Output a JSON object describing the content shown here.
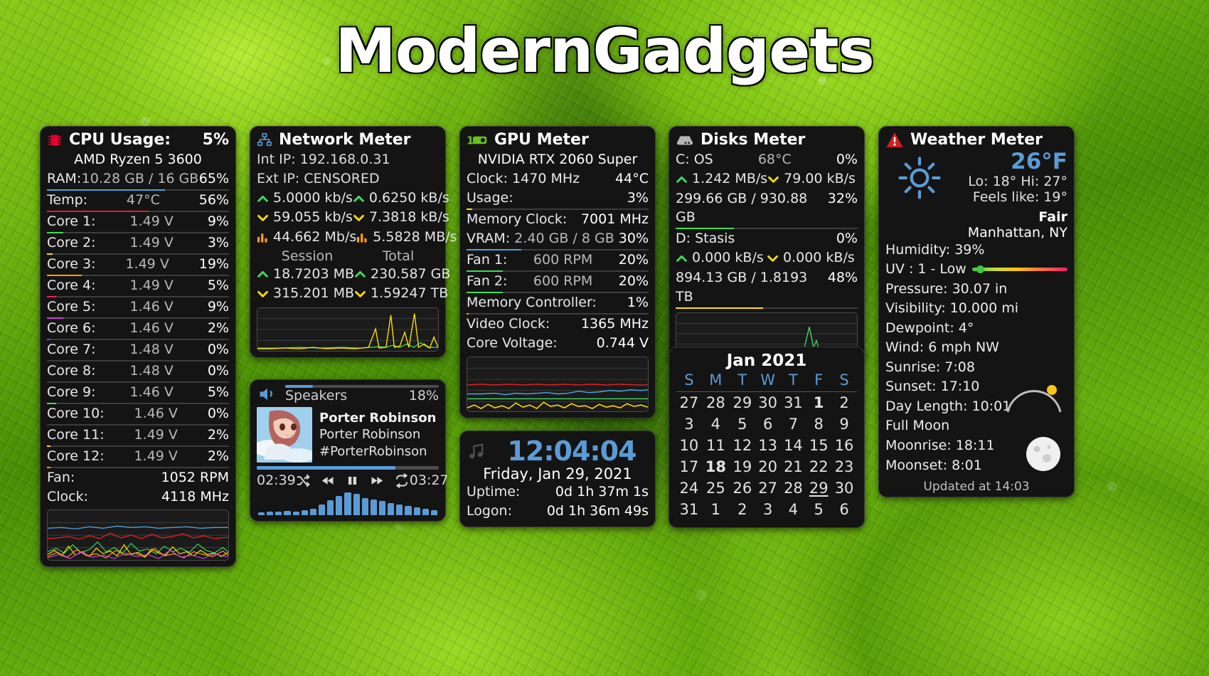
{
  "desktop": {
    "title": "ModernGadgets"
  },
  "cpu": {
    "icon": "cpu-chip-icon",
    "title": "CPU Usage:",
    "usage": "5%",
    "model": "AMD Ryzen 5 3600",
    "ram": {
      "label": "RAM:",
      "value": "10.28 GB / 16 GB",
      "pct": "65%",
      "bar_color": "#4aa3e0",
      "bar_pct": 65
    },
    "temp": {
      "label": "Temp:",
      "value": "47°C",
      "pct": "56%",
      "bar_color": "#e02020",
      "bar_pct": 56
    },
    "cores": [
      {
        "label": "Core 1:",
        "volts": "1.49 V",
        "pct": "9%",
        "bar_color": "#3ddd5c",
        "bar_pct": 9
      },
      {
        "label": "Core 2:",
        "volts": "1.49 V",
        "pct": "3%",
        "bar_color": "#ffe000",
        "bar_pct": 3
      },
      {
        "label": "Core 3:",
        "volts": "1.49 V",
        "pct": "19%",
        "bar_color": "#ff9d18",
        "bar_pct": 19
      },
      {
        "label": "Core 4:",
        "volts": "1.49 V",
        "pct": "5%",
        "bar_color": "#f0234c",
        "bar_pct": 5
      },
      {
        "label": "Core 5:",
        "volts": "1.46 V",
        "pct": "9%",
        "bar_color": "#d13ce0",
        "bar_pct": 9
      },
      {
        "label": "Core 6:",
        "volts": "1.46 V",
        "pct": "2%",
        "bar_color": "#7b3fe0",
        "bar_pct": 2
      },
      {
        "label": "Core 7:",
        "volts": "1.48 V",
        "pct": "0%",
        "bar_color": "#4aa3e0",
        "bar_pct": 0
      },
      {
        "label": "Core 8:",
        "volts": "1.48 V",
        "pct": "0%",
        "bar_color": "#00c8c8",
        "bar_pct": 0
      },
      {
        "label": "Core 9:",
        "volts": "1.46 V",
        "pct": "5%",
        "bar_color": "#3ddd5c",
        "bar_pct": 5
      },
      {
        "label": "Core 10:",
        "volts": "1.46 V",
        "pct": "0%",
        "bar_color": "#9bdd3d",
        "bar_pct": 0
      },
      {
        "label": "Core 11:",
        "volts": "1.49 V",
        "pct": "2%",
        "bar_color": "#ffe000",
        "bar_pct": 2
      },
      {
        "label": "Core 12:",
        "volts": "1.49 V",
        "pct": "2%",
        "bar_color": "#ff9d18",
        "bar_pct": 2
      }
    ],
    "fan": {
      "label": "Fan:",
      "value": "1052 RPM"
    },
    "clock": {
      "label": "Clock:",
      "value": "4118 MHz"
    }
  },
  "network": {
    "icon": "network-icon",
    "title": "Network Meter",
    "int_ip": "Int IP: 192.168.0.31",
    "ext_ip": "Ext IP: CENSORED",
    "rates": [
      {
        "left_icon": "up-arrow-icon",
        "left": "5.0000 kb/s",
        "right_icon": "up-arrow-icon",
        "right": "0.6250 kB/s"
      },
      {
        "left_icon": "down-arrow-icon",
        "left": "59.055 kb/s",
        "right_icon": "down-arrow-icon",
        "right": "7.3818 kB/s"
      },
      {
        "left_icon": "bars-icon",
        "left": "44.662 Mb/s",
        "right_icon": "bars-icon",
        "right": "5.5828 MB/s"
      }
    ],
    "col_headers": {
      "left": "Session",
      "right": "Total"
    },
    "totals": [
      {
        "left_icon": "up-arrow-icon",
        "left": "18.7203 MB",
        "right_icon": "up-arrow-icon",
        "right": "230.587 GB"
      },
      {
        "left_icon": "down-arrow-icon",
        "left": "315.201 MB",
        "right_icon": "down-arrow-icon",
        "right": "1.59247 TB"
      }
    ]
  },
  "media": {
    "icon": "speaker-icon",
    "device": "Speakers",
    "volume": "18%",
    "volume_pct": 18,
    "title": "Porter Robinson &...",
    "artist": "Porter Robinson",
    "album": "#PorterRobinson",
    "elapsed": "02:39",
    "duration": "03:27",
    "progress_pct": 76,
    "controls": [
      "shuffle-icon",
      "previous-icon",
      "pause-icon",
      "next-icon",
      "repeat-icon"
    ],
    "eq_levels": [
      12,
      14,
      16,
      18,
      16,
      20,
      26,
      44,
      62,
      78,
      95,
      88,
      72,
      66,
      58,
      50,
      44,
      38,
      32,
      26,
      22
    ]
  },
  "gpu": {
    "icon": "gpu-card-icon",
    "title": "GPU Meter",
    "model": "NVIDIA RTX 2060 Super",
    "clock": {
      "label": "Clock: 1470 MHz",
      "temp": "44°C"
    },
    "usage": {
      "label": "Usage:",
      "pct": "3%",
      "bar_color": "#ffe000",
      "bar_pct": 3
    },
    "memory_clock": {
      "label": "Memory Clock:",
      "value": "7001 MHz"
    },
    "vram": {
      "label": "VRAM:",
      "value": "2.40 GB / 8 GB",
      "pct": "30%",
      "bar_color": "#4aa3e0",
      "bar_pct": 30
    },
    "fan1": {
      "label": "Fan 1:",
      "value": "600 RPM",
      "pct": "20%",
      "bar_color": "#3ddd5c",
      "bar_pct": 20
    },
    "fan2": {
      "label": "Fan 2:",
      "value": "600 RPM",
      "pct": "20%",
      "bar_color": "#3ddd5c",
      "bar_pct": 20
    },
    "mem_controller": {
      "label": "Memory Controller:",
      "pct": "1%",
      "bar_color": "#ff9d18",
      "bar_pct": 1
    },
    "video_clock": {
      "label": "Video Clock:",
      "value": "1365 MHz"
    },
    "core_voltage": {
      "label": "Core Voltage:",
      "value": "0.744 V"
    }
  },
  "clock": {
    "icon": "music-note-icon",
    "time": "12:04:04",
    "date": "Friday, Jan 29, 2021",
    "uptime": {
      "label": "Uptime:",
      "value": "0d 1h 37m 1s"
    },
    "logon": {
      "label": "Logon:",
      "value": "0d 1h 36m 49s"
    }
  },
  "disks": {
    "icon": "hard-drive-icon",
    "title": "Disks Meter",
    "drives": [
      {
        "name": "C: OS",
        "temp": "68°C",
        "activity": "0%",
        "read_icon": "up-arrow-icon",
        "read": "1.242 MB/s",
        "write_icon": "down-arrow-icon",
        "write": "79.00 kB/s",
        "space": "299.66 GB / 930.88 GB",
        "used_pct": "32%",
        "bar_color": "#3ddd5c",
        "bar_pct": 32
      },
      {
        "name": "D: Stasis",
        "temp": "",
        "activity": "0%",
        "read_icon": "up-arrow-icon",
        "read": "0.000 kB/s",
        "write_icon": "down-arrow-icon",
        "write": "0.000 kB/s",
        "space": "894.13 GB / 1.8193 TB",
        "used_pct": "48%",
        "bar_color": "#ffe000",
        "bar_pct": 48
      }
    ]
  },
  "calendar": {
    "title": "Jan 2021",
    "weekdays": [
      "S",
      "M",
      "T",
      "W",
      "T",
      "F",
      "S"
    ],
    "weeks": [
      [
        {
          "d": "27",
          "s": "out"
        },
        {
          "d": "28",
          "s": "out"
        },
        {
          "d": "29",
          "s": "out"
        },
        {
          "d": "30",
          "s": "out"
        },
        {
          "d": "31",
          "s": "out"
        },
        {
          "d": "1",
          "s": "today"
        },
        {
          "d": "2",
          "s": ""
        }
      ],
      [
        {
          "d": "3",
          "s": ""
        },
        {
          "d": "4",
          "s": ""
        },
        {
          "d": "5",
          "s": ""
        },
        {
          "d": "6",
          "s": ""
        },
        {
          "d": "7",
          "s": ""
        },
        {
          "d": "8",
          "s": ""
        },
        {
          "d": "9",
          "s": ""
        }
      ],
      [
        {
          "d": "10",
          "s": ""
        },
        {
          "d": "11",
          "s": ""
        },
        {
          "d": "12",
          "s": "dim"
        },
        {
          "d": "13",
          "s": ""
        },
        {
          "d": "14",
          "s": ""
        },
        {
          "d": "15",
          "s": ""
        },
        {
          "d": "16",
          "s": ""
        }
      ],
      [
        {
          "d": "17",
          "s": ""
        },
        {
          "d": "18",
          "s": "today"
        },
        {
          "d": "19",
          "s": ""
        },
        {
          "d": "20",
          "s": ""
        },
        {
          "d": "21",
          "s": ""
        },
        {
          "d": "22",
          "s": ""
        },
        {
          "d": "23",
          "s": ""
        }
      ],
      [
        {
          "d": "24",
          "s": ""
        },
        {
          "d": "25",
          "s": ""
        },
        {
          "d": "26",
          "s": ""
        },
        {
          "d": "27",
          "s": ""
        },
        {
          "d": "28",
          "s": "dim"
        },
        {
          "d": "29",
          "s": "sel"
        },
        {
          "d": "30",
          "s": ""
        }
      ],
      [
        {
          "d": "31",
          "s": ""
        },
        {
          "d": "1",
          "s": "out"
        },
        {
          "d": "2",
          "s": "out"
        },
        {
          "d": "3",
          "s": "out"
        },
        {
          "d": "4",
          "s": "out"
        },
        {
          "d": "5",
          "s": "out"
        },
        {
          "d": "6",
          "s": "out"
        }
      ]
    ]
  },
  "weather": {
    "alert_icon": "warning-icon",
    "title": "Weather Meter",
    "condition_icon": "sun-icon",
    "temp": "26°F",
    "lo_hi": "Lo: 18°  Hi: 27°",
    "feels_like": "Feels like: 19°",
    "condition": "Fair",
    "location": "Manhattan, NY",
    "humidity": "Humidity: 39%",
    "uv": "UV : 1 - Low",
    "uv_pct": 8,
    "pressure": "Pressure: 30.07 in",
    "visibility": "Visibility: 10.000 mi",
    "dewpoint": "Dewpoint: 4°",
    "wind": "Wind: 6 mph NW",
    "sunrise": "Sunrise: 7:08",
    "sunset": "Sunset: 17:10",
    "day_length": "Day Length: 10:01",
    "moon_phase": "Full Moon",
    "moonrise": "Moonrise: 18:11",
    "moonset": "Moonset: 8:01",
    "updated": "Updated at 14:03"
  }
}
